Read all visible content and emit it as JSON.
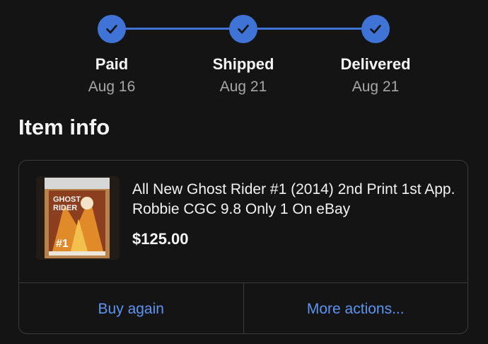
{
  "progress": {
    "steps": [
      {
        "label": "Paid",
        "date": "Aug 16",
        "status_icon": "check-icon"
      },
      {
        "label": "Shipped",
        "date": "Aug 21",
        "status_icon": "check-icon"
      },
      {
        "label": "Delivered",
        "date": "Aug 21",
        "status_icon": "check-icon"
      }
    ],
    "accent_color": "#3f73d6"
  },
  "item_info": {
    "heading": "Item info",
    "title": "All New Ghost Rider #1 (2014) 2nd Print 1st App. Robbie CGC 9.8 Only 1 On eBay",
    "price": "$125.00",
    "thumbnail_lettering": "GHOST RIDER #1",
    "actions": {
      "buy_again": "Buy again",
      "more_actions": "More actions..."
    },
    "link_color": "#5c94f2"
  }
}
